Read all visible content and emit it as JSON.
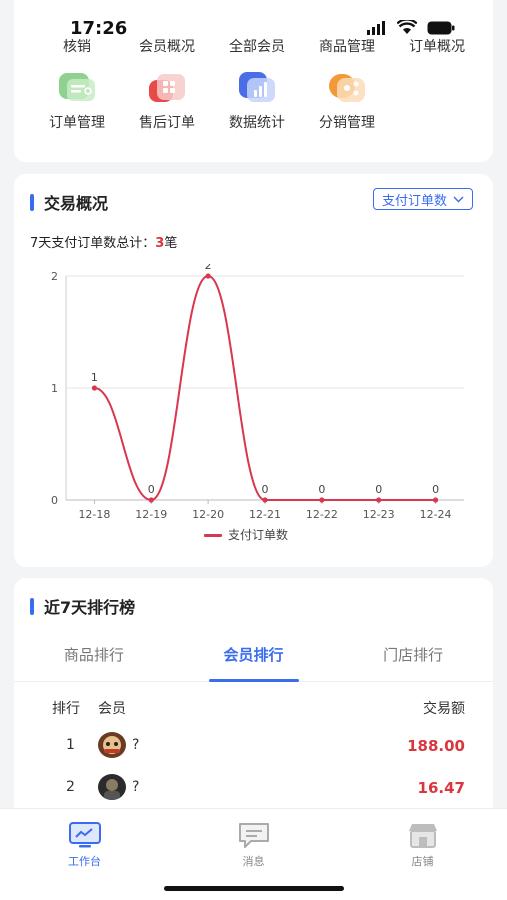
{
  "status": {
    "time": "17:26"
  },
  "menu": {
    "row1": [
      {
        "label": "核销",
        "icon": "verify-icon"
      },
      {
        "label": "会员概况",
        "icon": "member-overview-icon"
      },
      {
        "label": "全部会员",
        "icon": "all-members-icon"
      },
      {
        "label": "商品管理",
        "icon": "product-management-icon"
      },
      {
        "label": "订单概况",
        "icon": "order-overview-icon"
      }
    ],
    "row2": [
      {
        "label": "订单管理",
        "icon": "order-management-icon"
      },
      {
        "label": "售后订单",
        "icon": "after-sales-icon"
      },
      {
        "label": "数据统计",
        "icon": "data-statistics-icon"
      },
      {
        "label": "分销管理",
        "icon": "distribution-icon"
      }
    ]
  },
  "trade": {
    "title": "交易概况",
    "dropdown": "支付订单数",
    "total_prefix": "7天支付订单数总计：",
    "total_value": "3",
    "total_suffix": "笔"
  },
  "chart_data": {
    "type": "line",
    "categories": [
      "12-18",
      "12-19",
      "12-20",
      "12-21",
      "12-22",
      "12-23",
      "12-24"
    ],
    "series": [
      {
        "name": "支付订单数",
        "values": [
          1,
          0,
          2,
          0,
          0,
          0,
          0
        ],
        "color": "#d9364f"
      }
    ],
    "yticks": [
      0,
      1,
      2
    ],
    "ylim": [
      0,
      2
    ],
    "grid": true,
    "legend_position": "bottom"
  },
  "ranking": {
    "title": "近7天排行榜",
    "tabs": [
      "商品排行",
      "会员排行",
      "门店排行"
    ],
    "active_tab": 1,
    "headers": {
      "rank": "排行",
      "member": "会员",
      "amount": "交易额"
    },
    "rows": [
      {
        "rank": "1",
        "name": "?",
        "amount": "188.00"
      },
      {
        "rank": "2",
        "name": "?",
        "amount": "16.47"
      }
    ]
  },
  "tabbar": [
    {
      "label": "工作台",
      "icon": "workbench-icon",
      "active": true
    },
    {
      "label": "消息",
      "icon": "message-icon",
      "active": false
    },
    {
      "label": "店铺",
      "icon": "store-icon",
      "active": false
    }
  ],
  "colors": {
    "accent": "#3a6cf0",
    "red": "#d9363e"
  }
}
